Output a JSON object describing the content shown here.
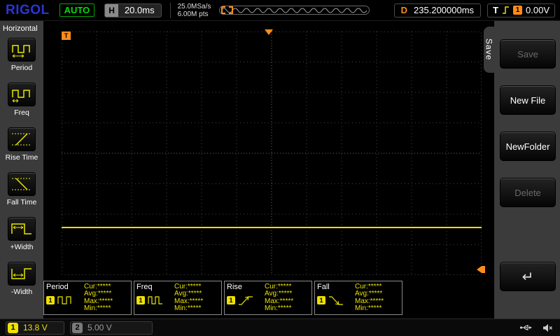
{
  "colors": {
    "channel1": "#f0e000",
    "channel2": "#9a9a9a",
    "trigger_orange": "#ff8c1a",
    "status_green": "#00e000",
    "logo_blue": "#2936d5"
  },
  "top_bar": {
    "logo": "RIGOL",
    "status": "AUTO",
    "h_label": "H",
    "timebase": "20.0ms",
    "sample_rate": "25.0MSa/s",
    "memory_depth": "6.00M pts",
    "d_label": "D",
    "delay": "235.200000ms",
    "t_label": "T",
    "trigger_source": "1",
    "trigger_level": "0.00V"
  },
  "left_menu": {
    "title": "Horizontal",
    "items": [
      {
        "label": "Period",
        "icon": "period-icon"
      },
      {
        "label": "Freq",
        "icon": "freq-icon"
      },
      {
        "label": "Rise Time",
        "icon": "rise-time-icon"
      },
      {
        "label": "Fall Time",
        "icon": "fall-time-icon"
      },
      {
        "label": "+Width",
        "icon": "plus-width-icon"
      },
      {
        "label": "-Width",
        "icon": "minus-width-icon"
      }
    ]
  },
  "display": {
    "trigger_corner_label": "T",
    "trace": {
      "channel": "1",
      "shape": "flat horizontal line",
      "color": "#f0e000"
    }
  },
  "measurements": [
    {
      "name": "Period",
      "channel": "1",
      "icon": "period-wave-icon",
      "values": {
        "cur": "Cur:*****",
        "avg": "Avg:*****",
        "max": "Max:*****",
        "min": "Min:*****"
      }
    },
    {
      "name": "Freq",
      "channel": "1",
      "icon": "freq-wave-icon",
      "values": {
        "cur": "Cur:*****",
        "avg": "Avg:*****",
        "max": "Max:*****",
        "min": "Min:*****"
      }
    },
    {
      "name": "Rise",
      "channel": "1",
      "icon": "rise-wave-icon",
      "values": {
        "cur": "Cur:*****",
        "avg": "Avg:*****",
        "max": "Max:*****",
        "min": "Min:*****"
      }
    },
    {
      "name": "Fall",
      "channel": "1",
      "icon": "fall-wave-icon",
      "values": {
        "cur": "Cur:*****",
        "avg": "Avg:*****",
        "max": "Max:*****",
        "min": "Min:*****"
      }
    }
  ],
  "right_menu": {
    "tab": "Save",
    "buttons": [
      {
        "label": "Save",
        "enabled": false
      },
      {
        "label": "New File",
        "enabled": true
      },
      {
        "label": "NewFolder",
        "enabled": true
      },
      {
        "label": "Delete",
        "enabled": false
      }
    ],
    "return_icon": "↵"
  },
  "bottom_bar": {
    "ch1_label": "1",
    "ch1_value": "13.8 V",
    "ch2_label": "2",
    "ch2_value": "5.00 V"
  }
}
